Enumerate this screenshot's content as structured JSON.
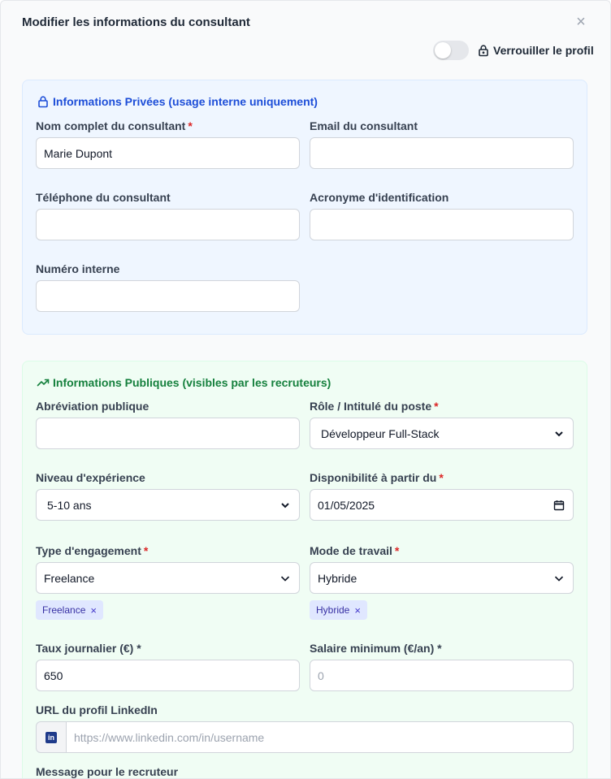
{
  "modal": {
    "title": "Modifier les informations du consultant",
    "close_glyph": "×",
    "lock_label": "Verrouiller le profil",
    "lock_toggle_on": false
  },
  "private": {
    "heading": "Informations Privées (usage interne uniquement)",
    "accent": "#1d4ed8",
    "fields": {
      "full_name": {
        "label": "Nom complet du consultant",
        "required": "*",
        "value": "Marie Dupont"
      },
      "email": {
        "label": "Email du consultant",
        "value": ""
      },
      "phone": {
        "label": "Téléphone du consultant",
        "value": ""
      },
      "acronym": {
        "label": "Acronyme d'identification",
        "value": ""
      },
      "internal_number": {
        "label": "Numéro interne",
        "value": ""
      }
    }
  },
  "public": {
    "heading": "Informations Publiques (visibles par les recruteurs)",
    "accent": "#15803d",
    "fields": {
      "public_abbr": {
        "label": "Abréviation publique",
        "value": ""
      },
      "role": {
        "label": "Rôle / Intitulé du poste",
        "required": "*",
        "value": "Développeur Full-Stack"
      },
      "experience": {
        "label": "Niveau d'expérience",
        "value": "5-10 ans"
      },
      "availability": {
        "label": "Disponibilité à partir du",
        "required": "*",
        "value": "01/05/2025"
      },
      "engagement": {
        "label": "Type d'engagement",
        "required": "*",
        "value": "Freelance",
        "chips": [
          "Freelance"
        ]
      },
      "work_mode": {
        "label": "Mode de travail",
        "required": "*",
        "value": "Hybride",
        "chips": [
          "Hybride"
        ]
      },
      "daily_rate": {
        "label": "Taux journalier (€) *",
        "value": "650"
      },
      "min_salary": {
        "label": "Salaire minimum (€/an) *",
        "placeholder": "0"
      },
      "linkedin": {
        "label": "URL du profil LinkedIn",
        "placeholder": "https://www.linkedin.com/in/username",
        "icon": "linkedin-icon"
      },
      "message": {
        "label": "Message pour le recruteur"
      }
    },
    "chip_x": "×"
  }
}
